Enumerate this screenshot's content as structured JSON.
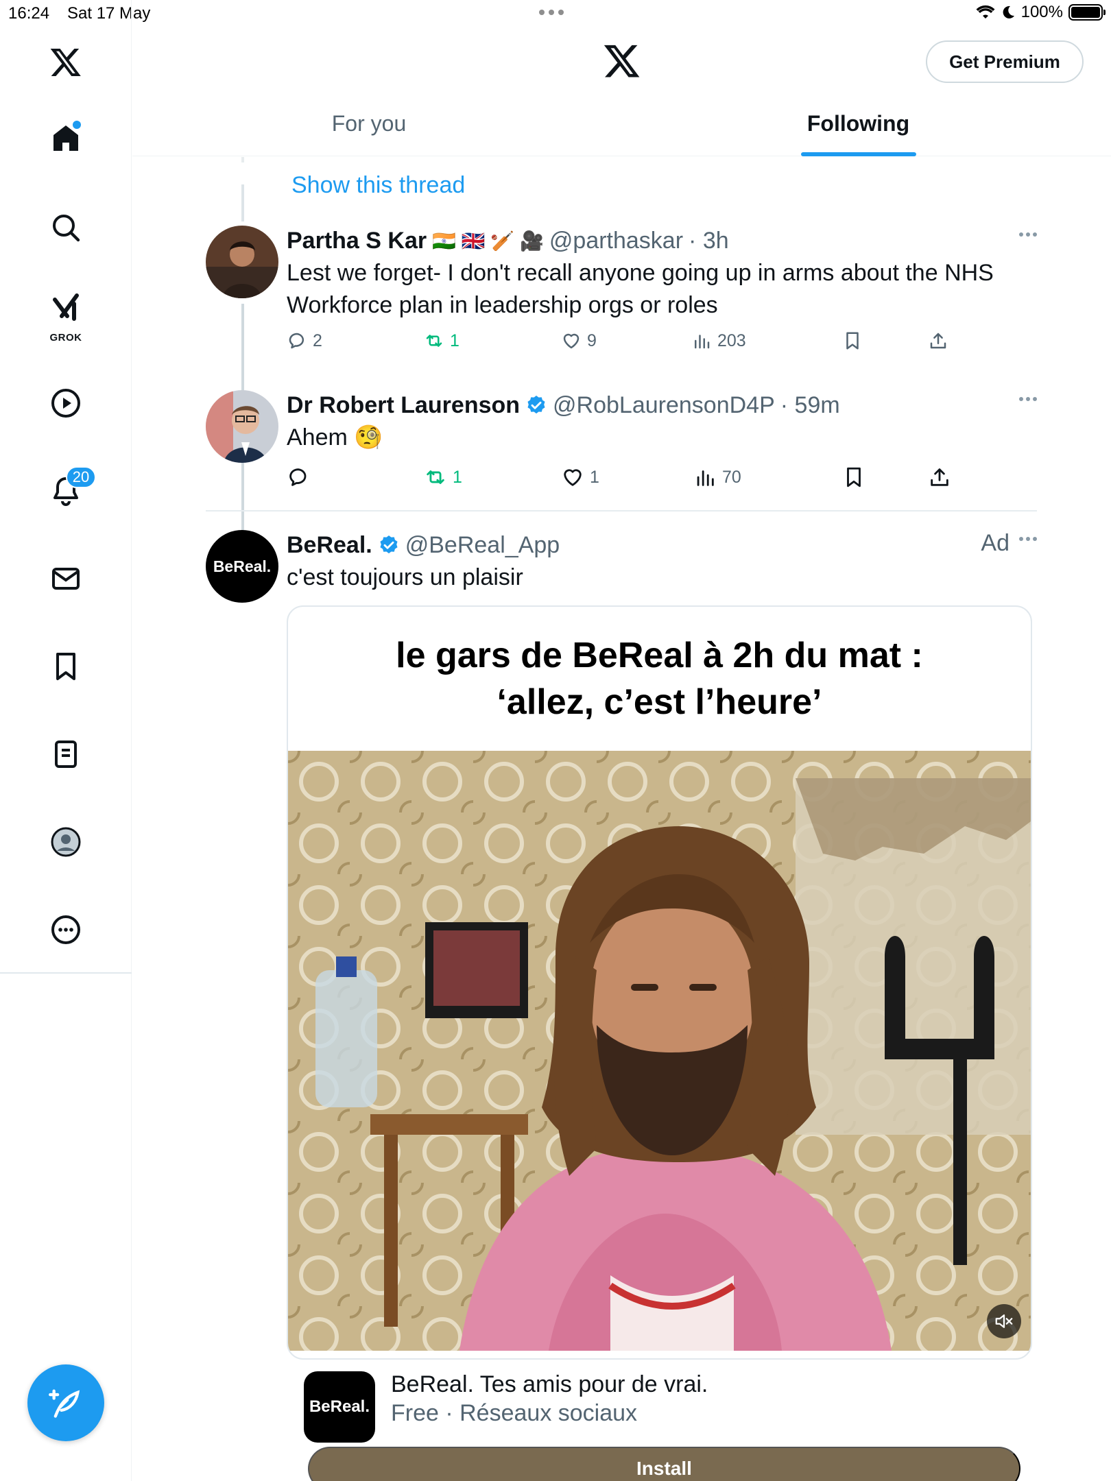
{
  "status_bar": {
    "time": "16:24",
    "date": "Sat 17 May",
    "battery": "100%"
  },
  "sidebar": {
    "items": [
      {
        "name": "home"
      },
      {
        "name": "search"
      },
      {
        "name": "grok",
        "label": "GROK"
      },
      {
        "name": "video"
      },
      {
        "name": "notifications",
        "badge": "20"
      },
      {
        "name": "messages"
      },
      {
        "name": "bookmarks"
      },
      {
        "name": "lists"
      },
      {
        "name": "profile"
      },
      {
        "name": "more"
      }
    ]
  },
  "header": {
    "premium_label": "Get Premium",
    "tabs": [
      {
        "label": "For you",
        "active": false
      },
      {
        "label": "Following",
        "active": true
      }
    ]
  },
  "feed": {
    "show_thread": "Show this thread",
    "tweets": [
      {
        "name": "Partha S Kar",
        "flags": "🇮🇳 🇬🇧 🏏 🎥",
        "handle": "@parthaskar",
        "time": "· 3h",
        "text": "Lest we forget- I don't recall anyone going up in arms about the NHS Workforce plan in leadership orgs or roles",
        "replies": "2",
        "retweets": "1",
        "likes": "9",
        "views": "203"
      },
      {
        "name": "Dr Robert Laurenson",
        "handle": "@RobLaurensonD4P",
        "time": "· 59m",
        "text": "Ahem 🧐",
        "replies": "",
        "retweets": "1",
        "likes": "1",
        "views": "70"
      }
    ],
    "ad": {
      "name": "BeReal.",
      "handle": "@BeReal_App",
      "ad_label": "Ad",
      "avatar_text": "BeReal.",
      "text": "c'est toujours un plaisir",
      "caption_line1": "le gars de BeReal à 2h du mat :",
      "caption_line2": "‘allez, c’est l’heure’",
      "app_logo_text": "BeReal.",
      "app_name": "BeReal. Tes amis pour de vrai.",
      "app_meta": "Free · Réseaux sociaux",
      "install_label": "Install"
    }
  },
  "colors": {
    "accent": "#1d9bf0",
    "retweet": "#00ba7c",
    "secondary_text": "#536471",
    "install_button": "#7a6a50"
  }
}
